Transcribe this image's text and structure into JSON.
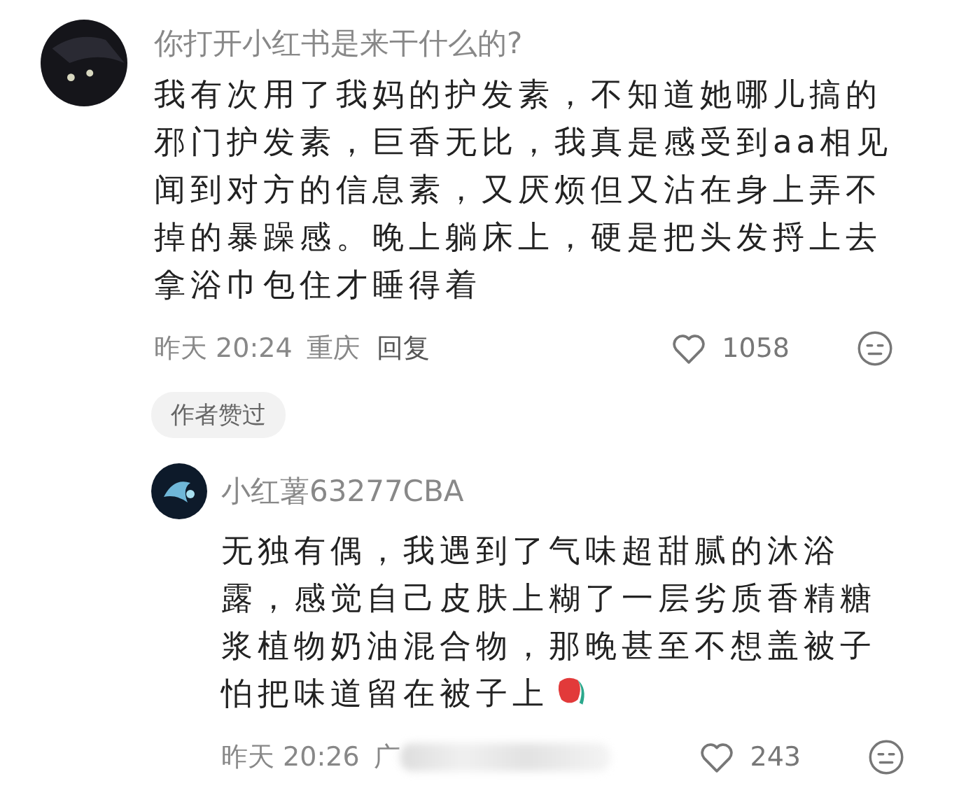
{
  "comment": {
    "username": "你打开小红书是来干什么的?",
    "text": "我有次用了我妈的护发素，不知道她哪儿搞的邪门护发素，巨香无比，我真是感受到aa相见闻到对方的信息素，又厌烦但又沾在身上弄不掉的暴躁感。晚上躺床上，硬是把头发捋上去拿浴巾包住才睡得着",
    "time": "昨天 20:24",
    "location": "重庆",
    "reply_label": "回复",
    "likes": "1058",
    "badge": "作者赞过",
    "replies": [
      {
        "username": "小红薯63277CBA",
        "text": "无独有偶，我遇到了气味超甜腻的沐浴露，感觉自己皮肤上糊了一层劣质香精糖浆植物奶油混合物，那晚甚至不想盖被子怕把味道留在被子上",
        "sticker": true,
        "time": "昨天 20:26",
        "location": "广",
        "blurred": true,
        "likes": "243"
      }
    ]
  }
}
